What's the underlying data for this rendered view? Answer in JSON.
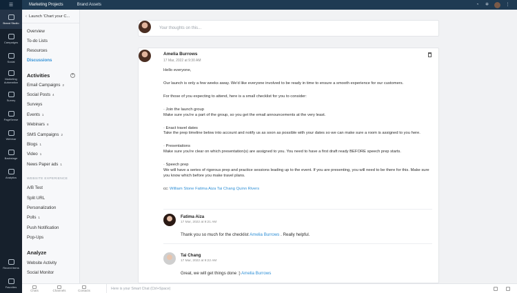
{
  "topbar": {
    "tabs": [
      {
        "label": "Marketing Projects"
      },
      {
        "label": "Brand Assets"
      }
    ]
  },
  "rail": {
    "items": [
      {
        "label": "Brand Studio",
        "icon": "brand-studio-icon"
      },
      {
        "label": "Campaigns",
        "icon": "campaigns-icon"
      },
      {
        "label": "Social",
        "icon": "social-icon"
      },
      {
        "label": "Marketing Automation",
        "icon": "automation-icon"
      },
      {
        "label": "Survey",
        "icon": "survey-icon"
      },
      {
        "label": "PageSense",
        "icon": "pagesense-icon"
      },
      {
        "label": "Webinar",
        "icon": "webinar-icon"
      },
      {
        "label": "Backstage",
        "icon": "backstage-icon"
      },
      {
        "label": "Analytics",
        "icon": "analytics-icon"
      }
    ],
    "bottom": [
      {
        "label": "Recent Items",
        "icon": "recent-items-icon"
      },
      {
        "label": "Favorites",
        "icon": "favorites-icon"
      }
    ]
  },
  "subnav": {
    "crumb": "Launch 'Chart your C...",
    "links": [
      {
        "label": "Overview"
      },
      {
        "label": "To-do Lists"
      },
      {
        "label": "Resources"
      },
      {
        "label": "Discussions"
      }
    ],
    "activities_title": "Activities",
    "activities": [
      {
        "label": "Email Campaigns",
        "count": "2"
      },
      {
        "label": "Social Posts",
        "count": "4"
      },
      {
        "label": "Surveys",
        "count": ""
      },
      {
        "label": "Events",
        "count": "1"
      },
      {
        "label": "Webinars",
        "count": "8"
      },
      {
        "label": "SMS Campaigns",
        "count": "2"
      },
      {
        "label": "Blogs",
        "count": "1"
      },
      {
        "label": "Video",
        "count": "1"
      },
      {
        "label": "News Paper ads",
        "count": "1"
      }
    ],
    "website_caption": "WEBSITE EXPERIENCE",
    "website_items": [
      {
        "label": "A/B Test",
        "count": ""
      },
      {
        "label": "Split URL",
        "count": ""
      },
      {
        "label": "Personalization",
        "count": ""
      },
      {
        "label": "Polls",
        "count": "1"
      },
      {
        "label": "Push Notification",
        "count": ""
      },
      {
        "label": "Pop-Ups",
        "count": ""
      }
    ],
    "analyze_title": "Analyze",
    "analyze_items": [
      {
        "label": "Website Activity"
      },
      {
        "label": "Social Monitor"
      }
    ]
  },
  "composer": {
    "placeholder": "Your thoughts on this..."
  },
  "post": {
    "author": "Amelia Burrows",
    "date": "17 Mar, 2022 at 9:30 AM",
    "paragraphs": [
      [
        "Hello everyone,"
      ],
      [
        "Our launch is only a few weeks away. We'd like everyone involved to be ready in time to ensure a smooth experience for our customers."
      ],
      [
        "For those of you expecting to attend, here is a small checklist for you to consider:"
      ],
      [
        "· Join the launch group",
        "Make sure you're a part of the group, so you get the email announcements at the very least."
      ],
      [
        "· Enact travel dates",
        "Take the prep timeline below into account and notify us as soon as possible with your dates so we can make sure a room is assigned to you here."
      ],
      [
        "· Presentations",
        "Make sure you're clear on which presentation(s) are assigned to you. You need to have a first draft ready BEFORE speech prep starts."
      ],
      [
        "· Speech prep",
        "We will have a series of rigorous prep and practice sessions leading up to the event. If you are presenting, you will need to be there for this. Make sure you know which before you make travel plans."
      ]
    ],
    "cc_prefix": "cc:",
    "cc_names": "William Stone Fatima Aiza Tai Chang Quinn Rivers"
  },
  "comments": [
    {
      "name": "Fatima Aiza",
      "date": "17 Mar, 2022 at 9:21 AM",
      "text_before": "Thank you so much for the checklist ",
      "mention": "Amelia Burrows",
      "text_after": " . Really helpful."
    },
    {
      "name": "Tai Chang",
      "date": "17 Mar, 2022 at 9:22 AM",
      "text_before": "Great, we will get things done :) ",
      "mention": "Amelia Burrows",
      "text_after": ""
    }
  ],
  "bottombar": {
    "items": [
      {
        "label": "Chats"
      },
      {
        "label": "Channels"
      },
      {
        "label": "Contacts"
      }
    ],
    "smartchat_placeholder": "Here is your Smart Chat (Ctrl+Space)"
  }
}
